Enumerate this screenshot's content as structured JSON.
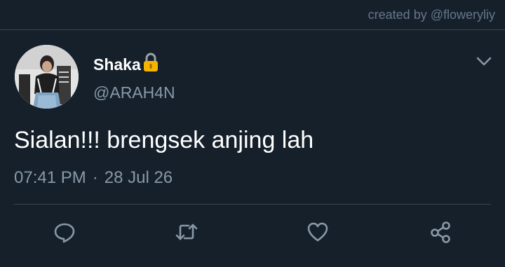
{
  "credit": "created by @floweryliy",
  "tweet": {
    "display_name": "Shaka",
    "handle": "@ARAH4N",
    "text": "Sialan!!! brengsek anjing lah",
    "time": "07:41 PM",
    "separator": "·",
    "date": "28 Jul 26"
  },
  "icons": {
    "avatar": "profile-photo",
    "lock": "lock-icon",
    "menu": "chevron-down-icon",
    "actions": [
      "reply-icon",
      "retweet-icon",
      "like-icon",
      "share-icon"
    ]
  },
  "colors": {
    "background": "#15202b",
    "divider": "#38444d",
    "secondary_text": "#8899a6",
    "lock": "#f4b400"
  }
}
